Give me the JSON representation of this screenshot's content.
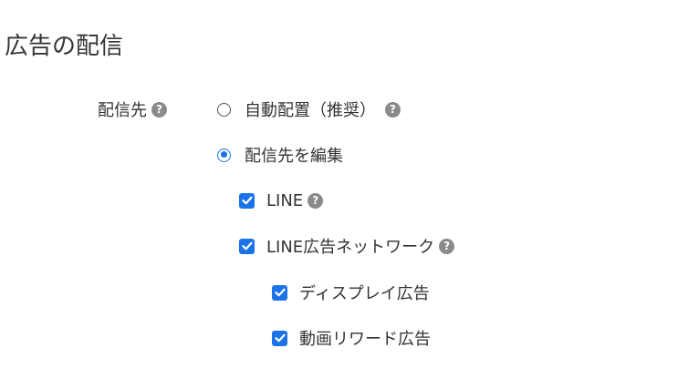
{
  "section": {
    "title": "広告の配信"
  },
  "placement": {
    "label": "配信先",
    "options": [
      {
        "label": "自動配置（推奨）",
        "selected": false,
        "has_help": true
      },
      {
        "label": "配信先を編集",
        "selected": true,
        "has_help": false
      }
    ],
    "destinations": [
      {
        "label": "LINE",
        "checked": true,
        "has_help": true,
        "level": 1
      },
      {
        "label": "LINE広告ネットワーク",
        "checked": true,
        "has_help": true,
        "level": 1
      },
      {
        "label": "ディスプレイ広告",
        "checked": true,
        "has_help": false,
        "level": 2
      },
      {
        "label": "動画リワード広告",
        "checked": true,
        "has_help": false,
        "level": 2
      }
    ]
  },
  "help_icon_glyph": "?",
  "colors": {
    "accent": "#1a73e8",
    "help_icon": "#8a8a8a",
    "text": "#333333"
  },
  "icons": {
    "help": "question-circle-icon",
    "checkmark": "checkmark-icon"
  }
}
